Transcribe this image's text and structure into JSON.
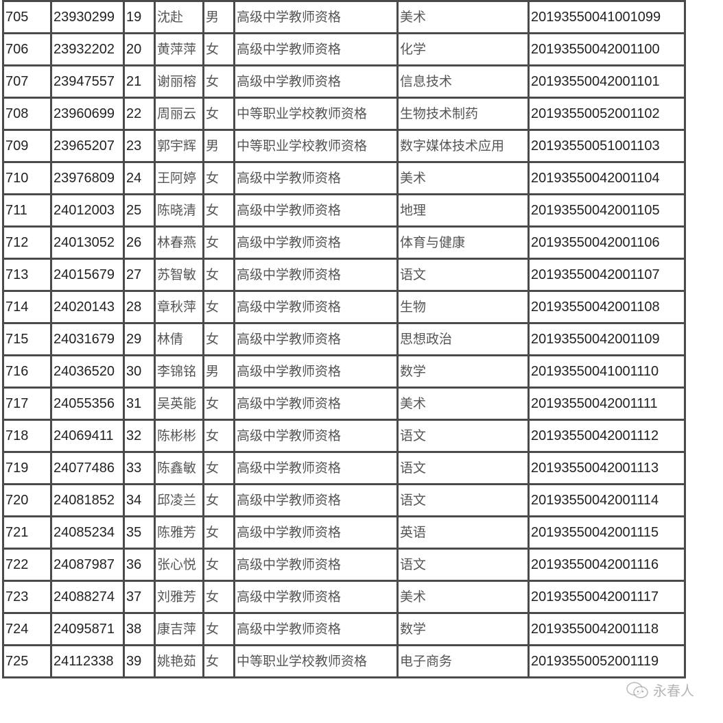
{
  "table": {
    "columns": [
      "seq",
      "exam_id",
      "no",
      "name",
      "gender",
      "cert_type",
      "subject",
      "cert_no"
    ],
    "rows": [
      [
        "705",
        "23930299",
        "19",
        "沈赴",
        "男",
        "高级中学教师资格",
        "美术",
        "20193550041001099"
      ],
      [
        "706",
        "23932202",
        "20",
        "黄萍萍",
        "女",
        "高级中学教师资格",
        "化学",
        "20193550042001100"
      ],
      [
        "707",
        "23947557",
        "21",
        "谢丽榕",
        "女",
        "高级中学教师资格",
        "信息技术",
        "20193550042001101"
      ],
      [
        "708",
        "23960699",
        "22",
        "周丽云",
        "女",
        "中等职业学校教师资格",
        "生物技术制药",
        "20193550052001102"
      ],
      [
        "709",
        "23965207",
        "23",
        "郭宇辉",
        "男",
        "中等职业学校教师资格",
        "数字媒体技术应用",
        "20193550051001103"
      ],
      [
        "710",
        "23976809",
        "24",
        "王阿婷",
        "女",
        "高级中学教师资格",
        "美术",
        "20193550042001104"
      ],
      [
        "711",
        "24012003",
        "25",
        "陈晓清",
        "女",
        "高级中学教师资格",
        "地理",
        "20193550042001105"
      ],
      [
        "712",
        "24013052",
        "26",
        "林春燕",
        "女",
        "高级中学教师资格",
        "体育与健康",
        "20193550042001106"
      ],
      [
        "713",
        "24015679",
        "27",
        "苏智敏",
        "女",
        "高级中学教师资格",
        "语文",
        "20193550042001107"
      ],
      [
        "714",
        "24020143",
        "28",
        "章秋萍",
        "女",
        "高级中学教师资格",
        "生物",
        "20193550042001108"
      ],
      [
        "715",
        "24031679",
        "29",
        "林倩",
        "女",
        "高级中学教师资格",
        "思想政治",
        "20193550042001109"
      ],
      [
        "716",
        "24036520",
        "30",
        "李锦铭",
        "男",
        "高级中学教师资格",
        "数学",
        "20193550041001110"
      ],
      [
        "717",
        "24055356",
        "31",
        "吴英能",
        "女",
        "高级中学教师资格",
        "美术",
        "20193550042001111"
      ],
      [
        "718",
        "24069411",
        "32",
        "陈彬彬",
        "女",
        "高级中学教师资格",
        "语文",
        "20193550042001112"
      ],
      [
        "719",
        "24077486",
        "33",
        "陈鑫敏",
        "女",
        "高级中学教师资格",
        "语文",
        "20193550042001113"
      ],
      [
        "720",
        "24081852",
        "34",
        "邱凌兰",
        "女",
        "高级中学教师资格",
        "语文",
        "20193550042001114"
      ],
      [
        "721",
        "24085234",
        "35",
        "陈雅芳",
        "女",
        "高级中学教师资格",
        "英语",
        "20193550042001115"
      ],
      [
        "722",
        "24087987",
        "36",
        "张心悦",
        "女",
        "高级中学教师资格",
        "语文",
        "20193550042001116"
      ],
      [
        "723",
        "24088274",
        "37",
        "刘雅芳",
        "女",
        "高级中学教师资格",
        "美术",
        "20193550042001117"
      ],
      [
        "724",
        "24095871",
        "38",
        "康吉萍",
        "女",
        "高级中学教师资格",
        "数学",
        "20193550042001118"
      ],
      [
        "725",
        "24112338",
        "39",
        "姚艳茹",
        "女",
        "中等职业学校教师资格",
        "电子商务",
        "20193550052001119"
      ]
    ]
  },
  "watermark": {
    "icon": "wechat-icon",
    "text": "永春人"
  },
  "colors": {
    "grid": "#4a4a4a",
    "text_latin": "#222222",
    "text_cjk": "#555555",
    "cell_bg": "#ffffff"
  }
}
